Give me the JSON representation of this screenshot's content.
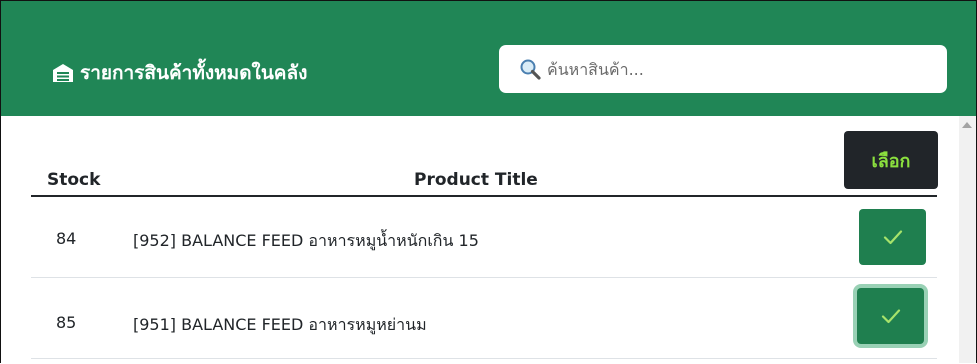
{
  "header": {
    "title": "รายการสินค้าทั้งหมดในคลัง",
    "title_icon": "warehouse-icon",
    "bg_color": "#208656"
  },
  "search": {
    "placeholder": "ค้นหาสินค้า...",
    "value": "",
    "icon": "search-icon"
  },
  "table": {
    "columns": {
      "stock": "Stock",
      "product_title": "Product Title",
      "select": "เลือก"
    },
    "rows": [
      {
        "stock": "84",
        "title": "[952] BALANCE FEED อาหารหมูน้ำหนักเกิน 15",
        "action_icon": "check-icon"
      },
      {
        "stock": "85",
        "title": "[951] BALANCE FEED อาหารหมูหย่านม",
        "action_icon": "check-icon",
        "focused": true
      }
    ]
  },
  "colors": {
    "accent": "#208656",
    "button": "#1f7f4f",
    "select_header_bg": "#212529",
    "select_header_text": "#8be03e"
  }
}
